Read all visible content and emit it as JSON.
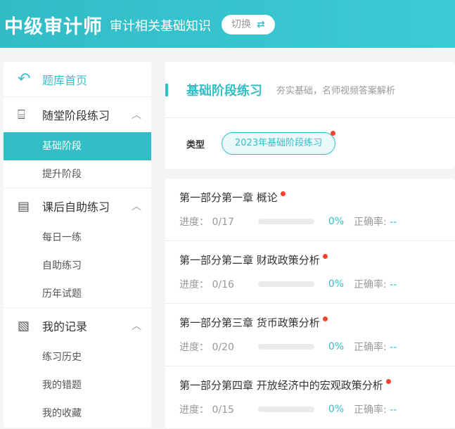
{
  "header": {
    "logo": "中级审计师",
    "subject": "审计相关基础知识",
    "switch_label": "切换",
    "switch_icon": "⇄"
  },
  "sidebar": {
    "home": "题库首页",
    "groups": [
      {
        "label": "随堂阶段练习",
        "items": [
          "基础阶段",
          "提升阶段"
        ]
      },
      {
        "label": "课后自助练习",
        "items": [
          "每日一练",
          "自助练习",
          "历年试题"
        ]
      },
      {
        "label": "我的记录",
        "items": [
          "练习历史",
          "我的错题",
          "我的收藏"
        ]
      }
    ],
    "active": "基础阶段"
  },
  "main": {
    "title": "基础阶段练习",
    "desc": "夯实基础，名师视频答案解析",
    "type_label": "类型",
    "type_value": "2023年基础阶段练习",
    "chapters": [
      {
        "name": "第一部分第一章 概论",
        "progress_label": "进度：",
        "progress": "0/17",
        "percent": "0%",
        "accuracy_label": "正确率:",
        "accuracy": "--"
      },
      {
        "name": "第一部分第二章 财政政策分析",
        "progress_label": "进度：",
        "progress": "0/16",
        "percent": "0%",
        "accuracy_label": "正确率:",
        "accuracy": "--"
      },
      {
        "name": "第一部分第三章 货币政策分析",
        "progress_label": "进度：",
        "progress": "0/20",
        "percent": "0%",
        "accuracy_label": "正确率:",
        "accuracy": "--"
      },
      {
        "name": "第一部分第四章 开放经济中的宏观政策分析",
        "progress_label": "进度：",
        "progress": "0/15",
        "percent": "0%",
        "accuracy_label": "正确率:",
        "accuracy": "--"
      }
    ]
  }
}
